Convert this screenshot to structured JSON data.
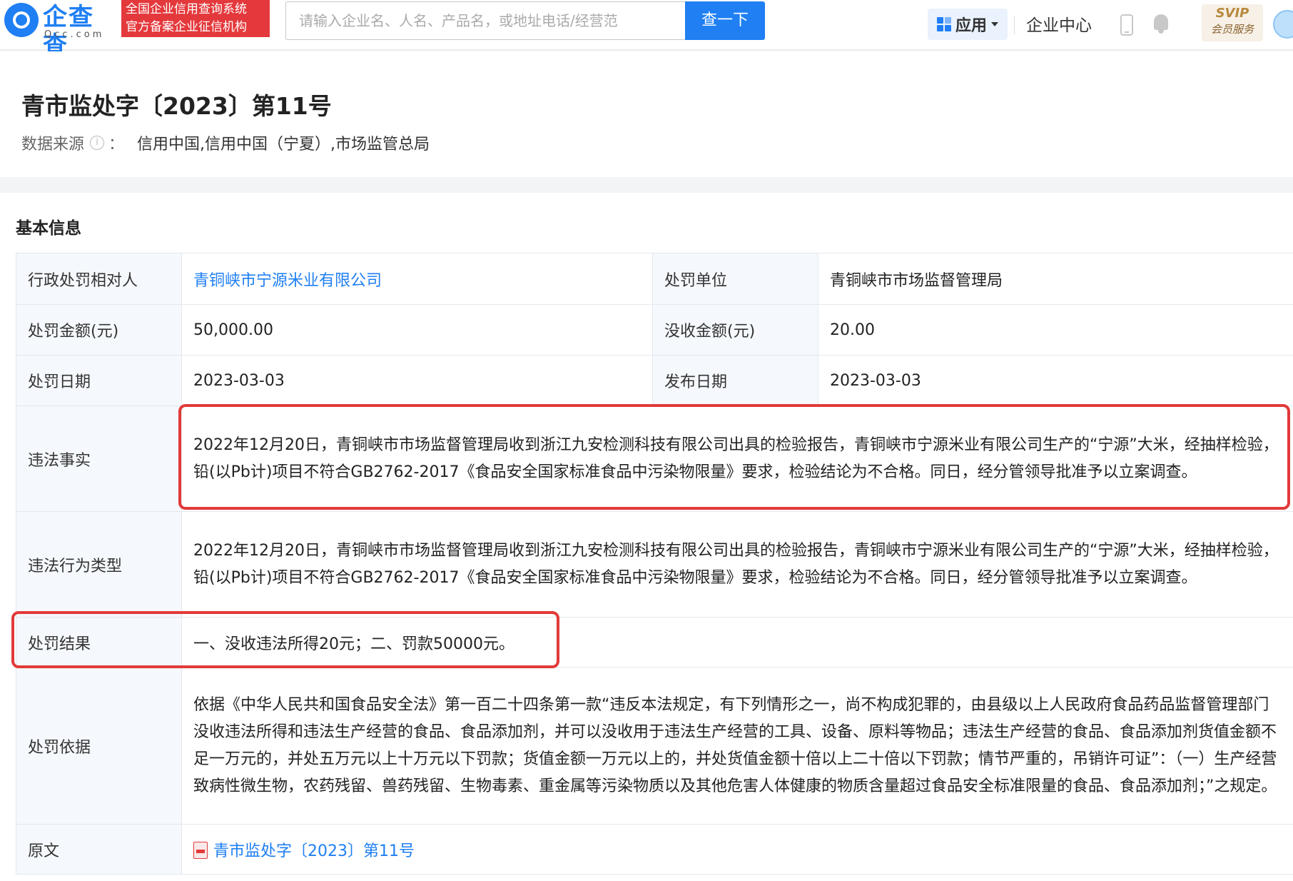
{
  "header": {
    "logo_text": "企查查",
    "logo_sub": "Qcc.com",
    "cert_line1": "全国企业信用查询系统",
    "cert_line2": "官方备案企业征信机构",
    "search_placeholder": "请输入企业名、人名、产品名，或地址电话/经营范",
    "search_button": "查一下",
    "apps_label": "应用",
    "enterprise_center": "企业中心",
    "svip_top": "SVIP",
    "svip_bottom": "会员服务"
  },
  "title_panel": {
    "title": "青市监处字〔2023〕第11号",
    "source_label": "数据来源",
    "source_colon": "：",
    "source_value": "信用中国,信用中国（宁夏）,市场监管总局"
  },
  "basic_info": {
    "section_title": "基本信息",
    "rows": {
      "party_label": "行政处罚相对人",
      "party_value": "青铜峡市宁源米业有限公司",
      "unit_label": "处罚单位",
      "unit_value": "青铜峡市市场监督管理局",
      "amount_label": "处罚金额(元)",
      "amount_value": "50,000.00",
      "confiscation_label": "没收金额(元)",
      "confiscation_value": "20.00",
      "date_label": "处罚日期",
      "date_value": "2023-03-03",
      "publish_label": "发布日期",
      "publish_value": "2023-03-03",
      "facts_label": "违法事实",
      "facts_value": "2022年12月20日，青铜峡市市场监督管理局收到浙江九安检测科技有限公司出具的检验报告，青铜峡市宁源米业有限公司生产的“宁源”大米，经抽样检验，铅(以Pb计)项目不符合GB2762-2017《食品安全国家标准食品中污染物限量》要求，检验结论为不合格。同日，经分管领导批准予以立案调查。",
      "type_label": "违法行为类型",
      "type_value": "2022年12月20日，青铜峡市市场监督管理局收到浙江九安检测科技有限公司出具的检验报告，青铜峡市宁源米业有限公司生产的“宁源”大米，经抽样检验，铅(以Pb计)项目不符合GB2762-2017《食品安全国家标准食品中污染物限量》要求，检验结论为不合格。同日，经分管领导批准予以立案调查。",
      "result_label": "处罚结果",
      "result_value": "一、没收违法所得20元；二、罚款50000元。",
      "basis_label": "处罚依据",
      "basis_value": "依据《中华人民共和国食品安全法》第一百二十四条第一款“违反本法规定，有下列情形之一，尚不构成犯罪的，由县级以上人民政府食品药品监督管理部门没收违法所得和违法生产经营的食品、食品添加剂，并可以没收用于违法生产经营的工具、设备、原料等物品；违法生产经营的食品、食品添加剂货值金额不足一万元的，并处五万元以上十万元以下罚款；货值金额一万元以上的，并处货值金额十倍以上二十倍以下罚款；情节严重的，吊销许可证”：（一）生产经营致病性微生物，农药残留、兽药残留、生物毒素、重金属等污染物质以及其他危害人体健康的物质含量超过食品安全标准限量的食品、食品添加剂；”之规定。",
      "original_label": "原文",
      "original_value": "青市监处字〔2023〕第11号"
    }
  },
  "colors": {
    "brand_blue": "#1f7ff3",
    "highlight_red": "#e23a3a",
    "label_bg": "#f5f8fc"
  }
}
